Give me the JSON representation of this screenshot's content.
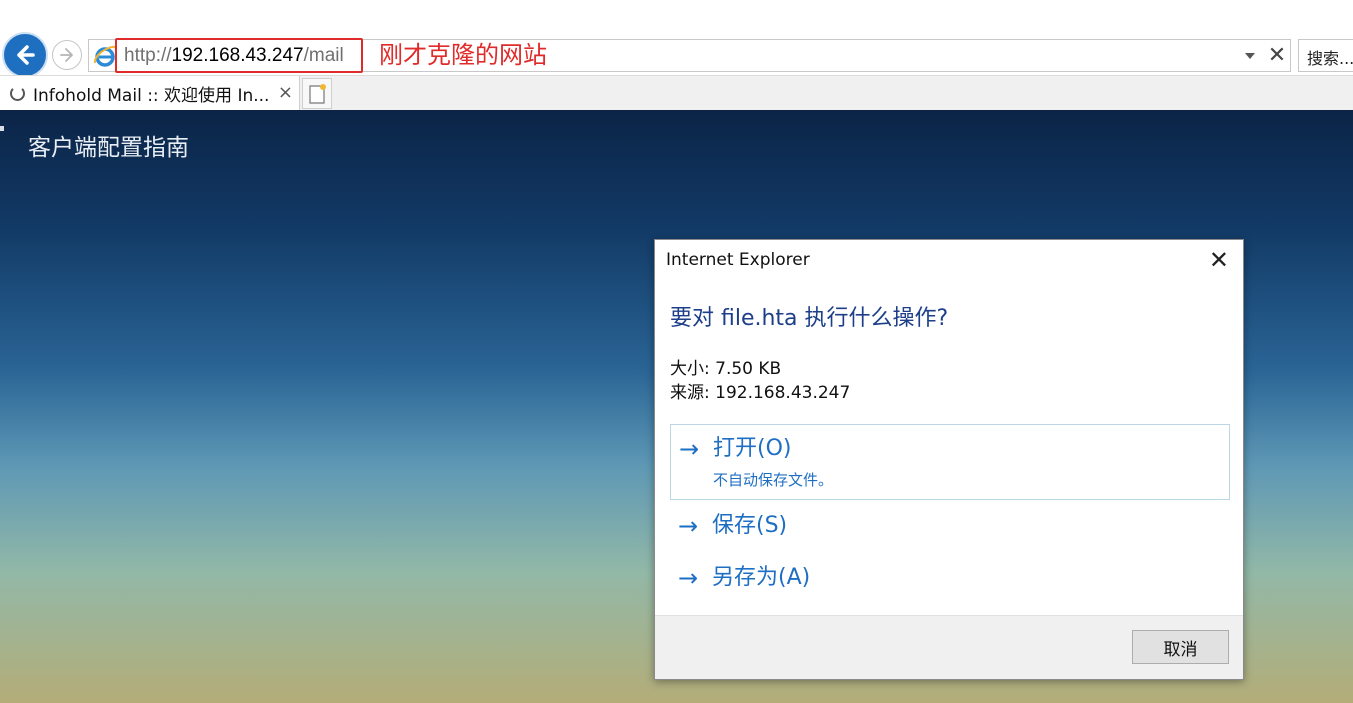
{
  "browser": {
    "address": {
      "url_prefix": "http://",
      "url_host": "192.168.43.247",
      "url_path": "/mail",
      "annotation": "刚才克隆的网站"
    },
    "search_placeholder": "搜索...",
    "tab": {
      "title": "Infohold Mail :: 欢迎使用 In...",
      "close": "×"
    }
  },
  "page": {
    "heading": "客户端配置指南"
  },
  "dialog": {
    "title": "Internet Explorer",
    "close": "✕",
    "question": "要对 file.hta 执行什么操作?",
    "size_label": "大小: 7.50 KB",
    "source_label": "来源: 192.168.43.247",
    "actions": [
      {
        "arrow": "→",
        "label": "打开(O)",
        "sub": "不自动保存文件。"
      },
      {
        "arrow": "→",
        "label": "保存(S)"
      },
      {
        "arrow": "→",
        "label": "另存为(A)"
      }
    ],
    "cancel": "取消"
  },
  "colors": {
    "accent": "#1e6ec4",
    "annotation_red": "#e02b2b"
  },
  "icons": [
    "back-arrow-icon",
    "forward-arrow-icon",
    "ie-logo-icon",
    "dropdown-arrow-icon",
    "stop-icon",
    "loading-spinner-icon",
    "new-tab-icon",
    "close-icon"
  ]
}
